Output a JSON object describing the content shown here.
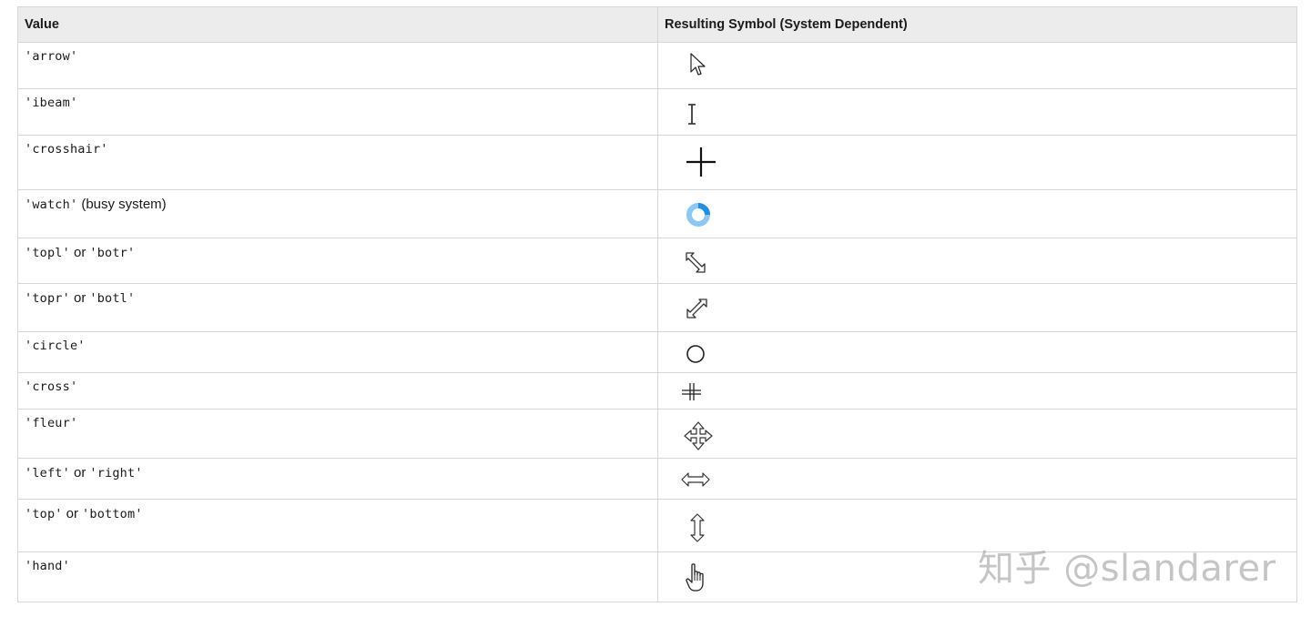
{
  "header": {
    "value_label": "Value",
    "symbol_label": "Resulting Symbol (System Dependent)"
  },
  "rows": [
    {
      "codes": [
        "'arrow'"
      ],
      "icon": "arrow-cursor-icon"
    },
    {
      "codes": [
        "'ibeam'"
      ],
      "icon": "ibeam-cursor-icon"
    },
    {
      "codes": [
        "'crosshair'"
      ],
      "icon": "crosshair-cursor-icon"
    },
    {
      "codes": [
        "'watch'"
      ],
      "suffix": "(busy system)",
      "icon": "busy-cursor-icon",
      "accent": "#1e8fe6"
    },
    {
      "codes": [
        "'topl'",
        "'botr'"
      ],
      "joiner": "or",
      "icon": "resize-nwse-icon"
    },
    {
      "codes": [
        "'topr'",
        "'botl'"
      ],
      "joiner": "or",
      "icon": "resize-nesw-icon"
    },
    {
      "codes": [
        "'circle'"
      ],
      "icon": "circle-cursor-icon"
    },
    {
      "codes": [
        "'cross'"
      ],
      "icon": "cross-cursor-icon"
    },
    {
      "codes": [
        "'fleur'"
      ],
      "icon": "fleur-move-icon"
    },
    {
      "codes": [
        "'left'",
        "'right'"
      ],
      "joiner": "or",
      "icon": "resize-horizontal-icon"
    },
    {
      "codes": [
        "'top'",
        "'bottom'"
      ],
      "joiner": "or",
      "icon": "resize-vertical-icon"
    },
    {
      "codes": [
        "'hand'"
      ],
      "icon": "hand-cursor-icon"
    }
  ],
  "watermark": "知乎 @slandarer"
}
